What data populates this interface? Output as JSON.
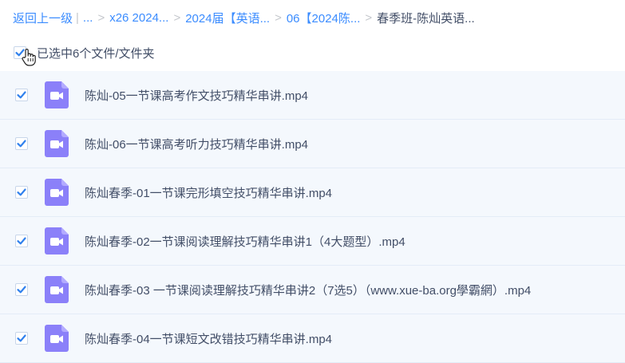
{
  "breadcrumb": {
    "back": "返回上一级",
    "ellipsis": "...",
    "items": [
      "x26 2024...",
      "2024届【英语...",
      "06【2024陈..."
    ],
    "current": "春季班-陈灿英语..."
  },
  "selection": {
    "text": "已选中6个文件/文件夹"
  },
  "files": [
    {
      "name": "陈灿-05一节课高考作文技巧精华串讲.mp4",
      "icon": "video-file-icon"
    },
    {
      "name": "陈灿-06一节课高考听力技巧精华串讲.mp4",
      "icon": "video-file-icon"
    },
    {
      "name": "陈灿春季-01一节课完形填空技巧精华串讲.mp4",
      "icon": "video-file-icon"
    },
    {
      "name": "陈灿春季-02一节课阅读理解技巧精华串讲1（4大题型）.mp4",
      "icon": "video-file-icon"
    },
    {
      "name": "陈灿春季-03 一节课阅读理解技巧精华串讲2（7选5）（www.xue-ba.org學霸網）.mp4",
      "icon": "video-file-icon"
    },
    {
      "name": "陈灿春季-04一节课短文改错技巧精华串讲.mp4",
      "icon": "video-file-icon"
    }
  ],
  "colors": {
    "link": "#3b8cff",
    "check": "#2f80ed",
    "video_icon": "#8b80f9",
    "row_bg": "#f4f8fd"
  }
}
